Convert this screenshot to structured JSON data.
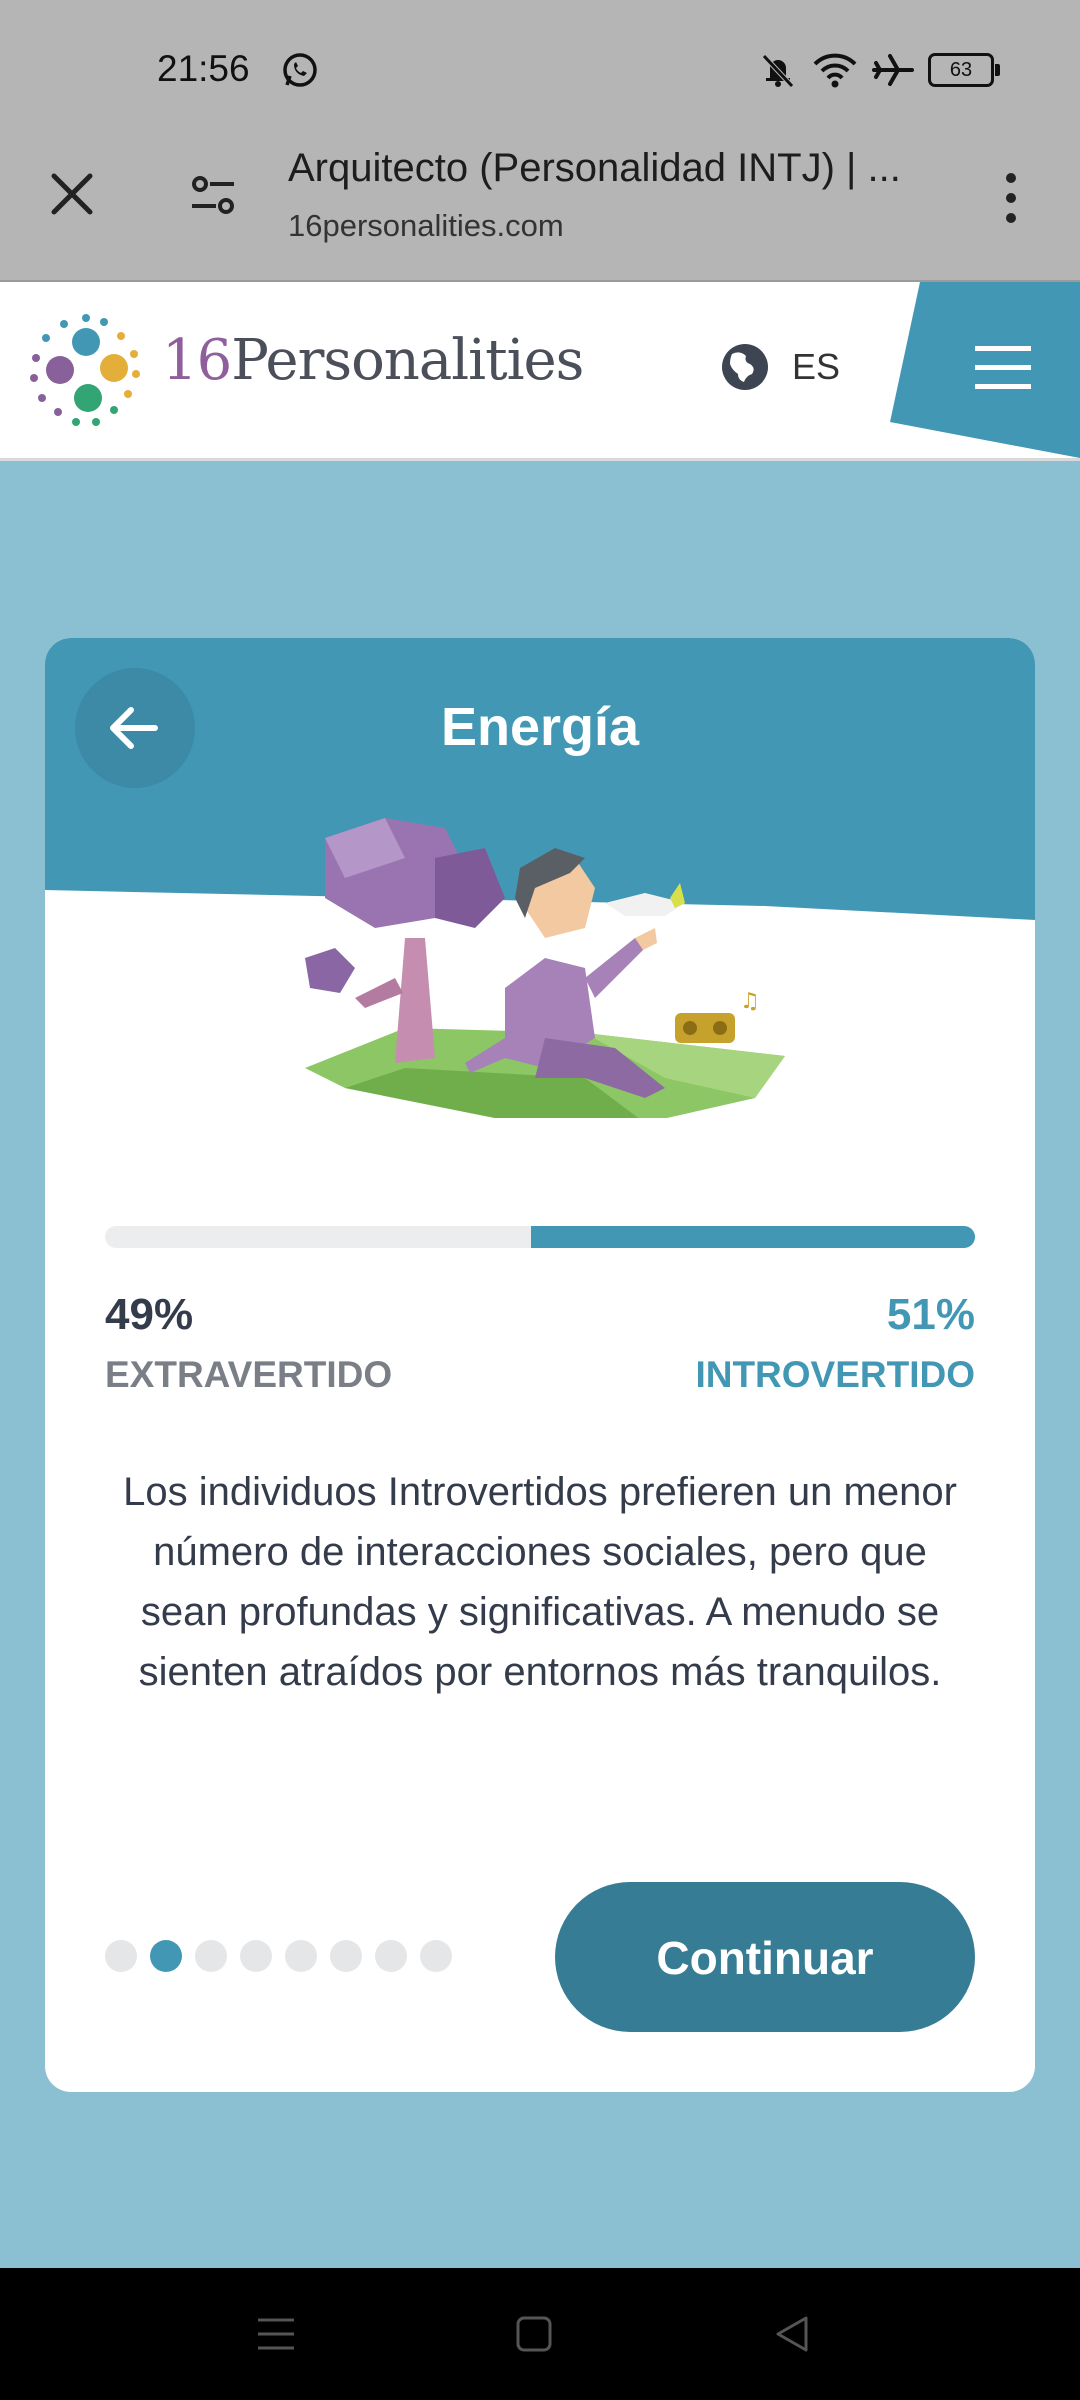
{
  "status_bar": {
    "time": "21:56",
    "battery": "63",
    "icons": [
      "whatsapp-icon",
      "bell-off-icon",
      "wifi-icon",
      "airplane-icon",
      "battery-icon"
    ]
  },
  "browser": {
    "page_title": "Arquitecto (Personalidad INTJ) | ...",
    "host": "16personalities.com"
  },
  "site": {
    "logo_number": "16",
    "logo_word": "Personalities",
    "language": "ES"
  },
  "card": {
    "title": "Energía",
    "progress": {
      "extraverted_percent": 49,
      "introverted_percent": 51,
      "left_percent_label": "49%",
      "right_percent_label": "51%",
      "left_trait": "EXTRAVERTIDO",
      "right_trait": "INTROVERTIDO"
    },
    "description": "Los individuos Introvertidos prefieren un menor número de interacciones sociales, pero que sean profundas y significativas. A menudo se sienten atraídos por entornos más tranquilos.",
    "pagination": {
      "total": 8,
      "current": 2
    },
    "continue_label": "Continuar"
  },
  "colors": {
    "accent": "#4298b4",
    "button": "#357c94",
    "page_background": "#8bbfd2",
    "text_dark": "#343c4b"
  }
}
